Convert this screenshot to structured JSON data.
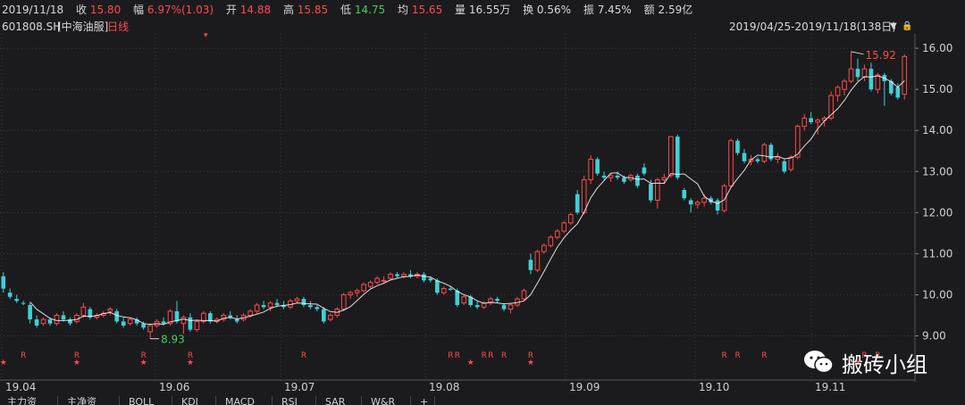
{
  "quote_bar": {
    "date": "2019/11/18",
    "close_label": "收",
    "close_value": "15.80",
    "change_label": "幅",
    "change_value": "6.97%(1.03)",
    "open_label": "开",
    "open_value": "14.88",
    "high_label": "高",
    "high_value": "15.85",
    "low_label": "低",
    "low_value": "14.75",
    "avg_label": "均",
    "avg_value": "15.65",
    "volume_label": "量",
    "volume_value": "16.55万",
    "turnover_label": "换",
    "turnover_value": "0.56%",
    "amplitude_label": "振",
    "amplitude_value": "7.45%",
    "amount_label": "额",
    "amount_value": "2.59亿"
  },
  "chart_header": {
    "stock_code": "601808.SH",
    "stock_name": "[中海油服]",
    "period": "日线",
    "range": "2019/04/25-2019/11/18(138日)"
  },
  "price_labels": {
    "high_marker": "15.92",
    "low_marker": "8.93"
  },
  "signal_labels": {
    "r": "R",
    "star": "★"
  },
  "bottom_tabs": [
    "主力资",
    "主净资",
    "BOLL",
    "KDJ",
    "MACD",
    "RSI",
    "SAR",
    "W&R",
    "+"
  ],
  "watermark": {
    "text": "搬砖小组",
    "icon": "wechat-icon"
  },
  "colors": {
    "up": "#ff4a4a",
    "down": "#3fd0d8",
    "ma": "#ffffff",
    "grid": "#3a3a3a"
  },
  "chart_data": {
    "type": "candlestick",
    "y_axis_ticks": [
      9.0,
      10.0,
      11.0,
      12.0,
      13.0,
      14.0,
      15.0,
      16.0
    ],
    "x_axis_ticks": [
      "19.04",
      "19.06",
      "19.07",
      "19.08",
      "19.09",
      "19.10",
      "19.11"
    ],
    "ylim": [
      8.75,
      16.35
    ],
    "ohlc": [
      [
        10.45,
        10.55,
        10.05,
        10.15
      ],
      [
        10.05,
        10.15,
        9.9,
        9.95
      ],
      [
        9.9,
        10.0,
        9.8,
        9.85
      ],
      [
        9.8,
        9.85,
        9.75,
        9.78
      ],
      [
        9.75,
        9.8,
        9.3,
        9.4
      ],
      [
        9.4,
        9.5,
        9.2,
        9.25
      ],
      [
        9.3,
        9.45,
        9.25,
        9.4
      ],
      [
        9.4,
        9.45,
        9.25,
        9.3
      ],
      [
        9.3,
        9.55,
        9.25,
        9.5
      ],
      [
        9.5,
        9.6,
        9.35,
        9.4
      ],
      [
        9.4,
        9.45,
        9.25,
        9.3
      ],
      [
        9.35,
        9.55,
        9.3,
        9.5
      ],
      [
        9.5,
        9.8,
        9.45,
        9.7
      ],
      [
        9.65,
        9.7,
        9.4,
        9.45
      ],
      [
        9.45,
        9.55,
        9.4,
        9.5
      ],
      [
        9.5,
        9.6,
        9.45,
        9.55
      ],
      [
        9.6,
        9.7,
        9.5,
        9.65
      ],
      [
        9.6,
        9.65,
        9.3,
        9.35
      ],
      [
        9.35,
        9.45,
        9.2,
        9.25
      ],
      [
        9.3,
        9.45,
        9.25,
        9.4
      ],
      [
        9.4,
        9.45,
        9.25,
        9.3
      ],
      [
        9.3,
        9.35,
        9.15,
        9.2
      ],
      [
        9.1,
        9.3,
        8.93,
        9.25
      ],
      [
        9.25,
        9.4,
        9.2,
        9.35
      ],
      [
        9.35,
        9.45,
        9.25,
        9.3
      ],
      [
        9.3,
        9.65,
        9.25,
        9.6
      ],
      [
        9.6,
        9.85,
        9.3,
        9.35
      ],
      [
        9.3,
        9.5,
        9.05,
        9.45
      ],
      [
        9.45,
        9.55,
        9.1,
        9.15
      ],
      [
        9.15,
        9.4,
        9.1,
        9.35
      ],
      [
        9.35,
        9.6,
        9.3,
        9.55
      ],
      [
        9.55,
        9.6,
        9.3,
        9.35
      ],
      [
        9.35,
        9.45,
        9.3,
        9.4
      ],
      [
        9.4,
        9.55,
        9.35,
        9.5
      ],
      [
        9.5,
        9.6,
        9.4,
        9.45
      ],
      [
        9.4,
        9.5,
        9.3,
        9.35
      ],
      [
        9.4,
        9.55,
        9.35,
        9.5
      ],
      [
        9.5,
        9.65,
        9.45,
        9.6
      ],
      [
        9.6,
        9.8,
        9.55,
        9.75
      ],
      [
        9.75,
        9.85,
        9.65,
        9.7
      ],
      [
        9.7,
        9.85,
        9.6,
        9.8
      ],
      [
        9.8,
        9.9,
        9.7,
        9.75
      ],
      [
        9.75,
        9.85,
        9.65,
        9.7
      ],
      [
        9.7,
        9.9,
        9.65,
        9.85
      ],
      [
        9.85,
        9.95,
        9.8,
        9.9
      ],
      [
        9.9,
        9.95,
        9.7,
        9.75
      ],
      [
        9.75,
        9.85,
        9.65,
        9.7
      ],
      [
        9.7,
        9.75,
        9.6,
        9.65
      ],
      [
        9.65,
        9.7,
        9.3,
        9.35
      ],
      [
        9.4,
        9.55,
        9.35,
        9.5
      ],
      [
        9.5,
        9.7,
        9.45,
        9.65
      ],
      [
        9.65,
        10.05,
        9.6,
        10.0
      ],
      [
        10.0,
        10.1,
        9.9,
        10.05
      ],
      [
        10.05,
        10.15,
        9.95,
        10.1
      ],
      [
        10.1,
        10.3,
        10.05,
        10.25
      ],
      [
        10.2,
        10.35,
        10.15,
        10.3
      ],
      [
        10.3,
        10.45,
        10.25,
        10.4
      ],
      [
        10.35,
        10.45,
        10.3,
        10.35
      ],
      [
        10.4,
        10.55,
        10.35,
        10.5
      ],
      [
        10.5,
        10.55,
        10.4,
        10.45
      ],
      [
        10.45,
        10.55,
        10.4,
        10.5
      ],
      [
        10.5,
        10.6,
        10.4,
        10.45
      ],
      [
        10.45,
        10.55,
        10.4,
        10.5
      ],
      [
        10.5,
        10.55,
        10.3,
        10.35
      ],
      [
        10.4,
        10.45,
        10.3,
        10.35
      ],
      [
        10.35,
        10.4,
        10.0,
        10.05
      ],
      [
        10.05,
        10.2,
        10.0,
        10.15
      ],
      [
        10.15,
        10.2,
        10.1,
        10.12
      ],
      [
        10.1,
        10.15,
        9.7,
        9.75
      ],
      [
        9.8,
        10.0,
        9.75,
        9.95
      ],
      [
        9.95,
        10.0,
        9.7,
        9.75
      ],
      [
        9.75,
        9.85,
        9.65,
        9.7
      ],
      [
        9.7,
        9.85,
        9.65,
        9.8
      ],
      [
        9.8,
        9.95,
        9.75,
        9.9
      ],
      [
        9.9,
        9.95,
        9.8,
        9.85
      ],
      [
        9.75,
        9.8,
        9.6,
        9.65
      ],
      [
        9.65,
        9.8,
        9.55,
        9.75
      ],
      [
        9.75,
        9.95,
        9.7,
        9.9
      ],
      [
        9.9,
        10.15,
        9.85,
        10.1
      ],
      [
        10.85,
        11.0,
        10.5,
        10.6
      ],
      [
        10.6,
        11.1,
        10.55,
        11.05
      ],
      [
        11.05,
        11.25,
        11.0,
        11.2
      ],
      [
        11.2,
        11.45,
        11.15,
        11.4
      ],
      [
        11.4,
        11.6,
        11.35,
        11.55
      ],
      [
        11.55,
        11.8,
        11.5,
        11.75
      ],
      [
        11.75,
        12.0,
        11.7,
        11.95
      ],
      [
        12.45,
        12.55,
        11.95,
        12.0
      ],
      [
        12.0,
        12.9,
        11.95,
        12.8
      ],
      [
        12.8,
        13.4,
        12.7,
        13.3
      ],
      [
        13.3,
        13.35,
        12.9,
        12.95
      ],
      [
        12.9,
        13.0,
        12.8,
        12.85
      ],
      [
        12.85,
        12.95,
        12.75,
        12.9
      ],
      [
        12.9,
        13.0,
        12.8,
        12.85
      ],
      [
        12.85,
        12.9,
        12.7,
        12.75
      ],
      [
        12.8,
        12.95,
        12.75,
        12.9
      ],
      [
        12.9,
        12.95,
        12.6,
        12.65
      ],
      [
        13.1,
        13.2,
        12.9,
        12.95
      ],
      [
        12.7,
        12.8,
        12.25,
        12.3
      ],
      [
        12.3,
        12.85,
        12.1,
        12.8
      ],
      [
        12.8,
        12.95,
        12.7,
        12.85
      ],
      [
        12.9,
        13.85,
        12.85,
        13.85
      ],
      [
        13.85,
        13.9,
        12.8,
        12.85
      ],
      [
        12.55,
        12.6,
        12.3,
        12.35
      ],
      [
        12.3,
        12.35,
        12.0,
        12.2
      ],
      [
        12.2,
        12.3,
        12.1,
        12.25
      ],
      [
        12.25,
        12.45,
        12.15,
        12.35
      ],
      [
        12.35,
        12.4,
        12.2,
        12.25
      ],
      [
        12.3,
        12.35,
        11.95,
        12.05
      ],
      [
        12.05,
        12.7,
        12.0,
        12.65
      ],
      [
        12.65,
        13.8,
        12.6,
        13.75
      ],
      [
        13.75,
        13.8,
        13.4,
        13.45
      ],
      [
        13.45,
        13.55,
        13.2,
        13.25
      ],
      [
        13.25,
        13.4,
        13.15,
        13.3
      ],
      [
        13.3,
        13.35,
        13.2,
        13.25
      ],
      [
        13.25,
        13.7,
        13.2,
        13.65
      ],
      [
        13.65,
        13.7,
        13.25,
        13.3
      ],
      [
        13.3,
        13.45,
        13.2,
        13.35
      ],
      [
        13.25,
        13.3,
        12.95,
        13.0
      ],
      [
        13.05,
        13.4,
        13.0,
        13.35
      ],
      [
        13.35,
        14.15,
        13.3,
        14.1
      ],
      [
        14.1,
        14.4,
        14.0,
        14.3
      ],
      [
        14.3,
        14.45,
        14.15,
        14.2
      ],
      [
        14.2,
        14.3,
        13.9,
        14.25
      ],
      [
        14.25,
        14.35,
        14.1,
        14.3
      ],
      [
        14.3,
        14.95,
        14.25,
        14.85
      ],
      [
        14.85,
        15.1,
        14.7,
        15.05
      ],
      [
        15.0,
        15.25,
        14.85,
        15.2
      ],
      [
        15.2,
        15.92,
        15.15,
        15.5
      ],
      [
        15.5,
        15.75,
        15.2,
        15.3
      ],
      [
        15.3,
        15.6,
        15.2,
        15.5
      ],
      [
        15.5,
        15.65,
        14.95,
        15.0
      ],
      [
        15.0,
        15.4,
        14.9,
        15.35
      ],
      [
        15.35,
        15.4,
        14.6,
        15.2
      ],
      [
        15.2,
        15.25,
        14.85,
        14.9
      ],
      [
        15.05,
        15.15,
        14.75,
        14.8
      ],
      [
        14.88,
        15.85,
        14.75,
        15.8
      ]
    ],
    "ma_line": true,
    "grid": true,
    "signals_r_positions": [
      3,
      11,
      21,
      28,
      45,
      67,
      68,
      72,
      73,
      75,
      79,
      108,
      110,
      114,
      129,
      131
    ],
    "signals_star_positions": [
      0,
      11,
      21,
      28,
      70,
      79,
      128
    ]
  }
}
